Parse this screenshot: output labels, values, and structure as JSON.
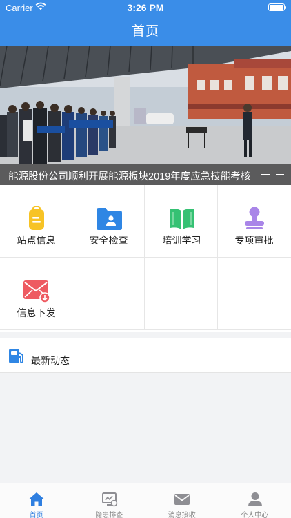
{
  "status_bar": {
    "carrier": "Carrier",
    "time": "3:26 PM"
  },
  "header": {
    "title": "首页"
  },
  "banner": {
    "caption": "能源股份公司顺利开展能源板块2019年度应急技能考核",
    "page_indicator_count": 2
  },
  "menu": {
    "items": [
      {
        "label": "站点信息",
        "icon": "station-tag-icon",
        "color": "#f7c325"
      },
      {
        "label": "安全检查",
        "icon": "folder-user-icon",
        "color": "#2f86e4"
      },
      {
        "label": "培训学习",
        "icon": "open-book-icon",
        "color": "#35c173"
      },
      {
        "label": "专项审批",
        "icon": "approval-stamp-icon",
        "color": "#a985e8"
      },
      {
        "label": "信息下发",
        "icon": "mail-download-icon",
        "color": "#ee5a61"
      }
    ]
  },
  "news": {
    "title": "最新动态",
    "icon": "fuel-pump-icon",
    "color": "#2f86e4"
  },
  "tabbar": {
    "tabs": [
      {
        "label": "首页",
        "icon": "home-icon",
        "active": true
      },
      {
        "label": "隐患排查",
        "icon": "hazard-monitor-icon",
        "active": false
      },
      {
        "label": "消息接收",
        "icon": "envelope-icon",
        "active": false
      },
      {
        "label": "个人中心",
        "icon": "person-icon",
        "active": false
      }
    ],
    "active_color": "#2f7fe0",
    "inactive_color": "#8e8e93"
  },
  "colors": {
    "header_bg": "#3a8de8",
    "page_bg": "#f2f3f5"
  }
}
